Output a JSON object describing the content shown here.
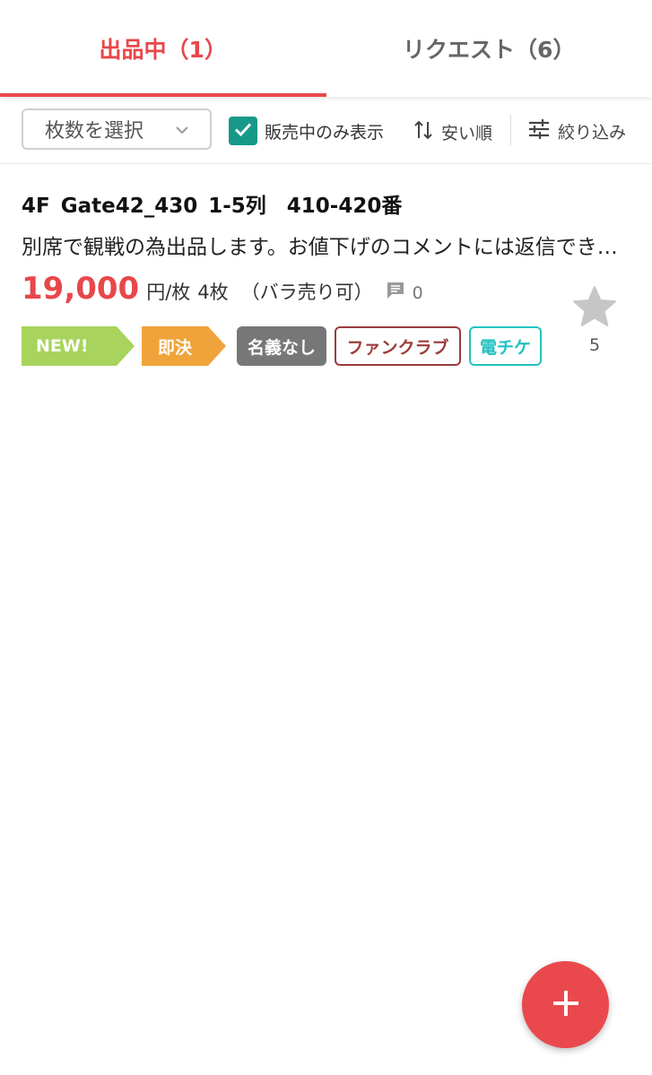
{
  "tabs": [
    {
      "label": "出品中（1）",
      "active": true
    },
    {
      "label": "リクエスト（6）",
      "active": false
    }
  ],
  "filters": {
    "quantity_select": "枚数を選択",
    "on_sale_only_label": "販売中のみ表示",
    "on_sale_only_checked": true,
    "sort_label": "安い順",
    "refine_label": "絞り込み"
  },
  "listing": {
    "title": "4F  Gate42_430  1-5列　410-420番",
    "description": "別席で観戦の為出品します。お値下げのコメントには返信できません。",
    "price": "19,000",
    "unit": "円/枚",
    "quantity": "4枚",
    "note": "（バラ売り可）",
    "comment_count": "0",
    "favorite_count": "5",
    "tags": {
      "new": "NEW!",
      "instant": "即決",
      "no_name": "名義なし",
      "fanclub": "ファンクラブ",
      "eticket": "電チケ"
    }
  },
  "colors": {
    "accent": "#e8474a",
    "checkbox": "#17998a",
    "tag_new": "#a8d35c",
    "tag_instant": "#f0a33b",
    "tag_no_name": "#777777",
    "tag_fanclub": "#9b3c3c",
    "tag_eticket": "#23c2c2"
  },
  "icons": {
    "chevron": "chevron-down-icon",
    "check": "check-icon",
    "sort": "sort-arrows-icon",
    "refine": "sliders-icon",
    "comment": "comment-icon",
    "favorite": "star-icon",
    "add": "plus-icon"
  }
}
